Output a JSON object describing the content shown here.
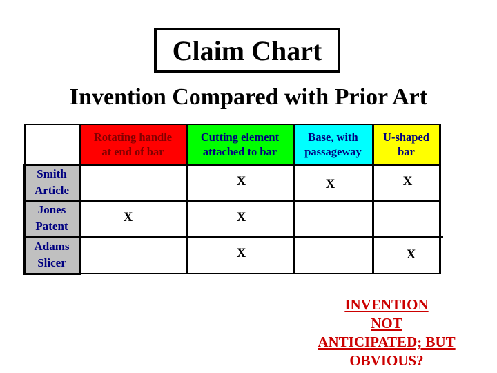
{
  "title": "Claim Chart",
  "subtitle": "Invention Compared with Prior Art",
  "table": {
    "columns": [
      {
        "label_line1": "Rotating handle",
        "label_line2": "at end of bar",
        "color": "#ff0000",
        "text_color": "#800000"
      },
      {
        "label_line1": "Cutting element",
        "label_line2": "attached to bar",
        "color": "#00ff00",
        "text_color": "#000080"
      },
      {
        "label_line1": "Base, with",
        "label_line2": "passageway",
        "color": "#00ffff",
        "text_color": "#000080"
      },
      {
        "label_line1": "U-shaped",
        "label_line2": "bar",
        "color": "#ffff00",
        "text_color": "#000080"
      }
    ],
    "rows": [
      {
        "label_line1": "Smith",
        "label_line2": "Article",
        "cells": [
          "",
          "X",
          "X",
          "X"
        ]
      },
      {
        "label_line1": "Jones",
        "label_line2": "Patent",
        "cells": [
          "X",
          "X",
          "",
          ""
        ]
      },
      {
        "label_line1": "Adams",
        "label_line2": "Slicer",
        "cells": [
          "",
          "X",
          "",
          "X"
        ]
      }
    ]
  },
  "verdict": {
    "line1": "INVENTION",
    "line2": "NOT",
    "line3": "ANTICIPATED; BUT",
    "line4": "OBVIOUS?",
    "color": "#cc0000"
  }
}
